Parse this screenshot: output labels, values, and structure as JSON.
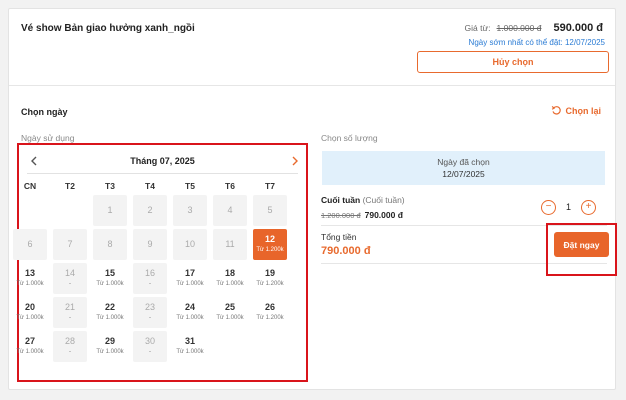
{
  "show": {
    "title": "Vé show Bản giao hưởng xanh_ngồi",
    "price_from_label": "Giá từ:",
    "price_old": "1.000.000 đ",
    "price_new": "590.000 đ",
    "earliest": "Ngày sớm nhất có thể đặt: 12/07/2025",
    "cancel_label": "Hủy chọn"
  },
  "date_section": {
    "title": "Chọn ngày",
    "reset_label": "Chọn lại",
    "usage_label": "Ngày sử dụng"
  },
  "calendar": {
    "month_label": "Tháng 07, 2025",
    "weekdays": [
      "CN",
      "T2",
      "T3",
      "T4",
      "T5",
      "T6",
      "T7"
    ],
    "cells": [
      {
        "day": "1",
        "sub": "",
        "state": "disabled"
      },
      {
        "day": "2",
        "sub": "",
        "state": "disabled"
      },
      {
        "day": "3",
        "sub": "",
        "state": "disabled"
      },
      {
        "day": "4",
        "sub": "",
        "state": "disabled"
      },
      {
        "day": "5",
        "sub": "",
        "state": "disabled"
      },
      {
        "day": "6",
        "sub": "",
        "state": "disabled"
      },
      {
        "day": "7",
        "sub": "",
        "state": "disabled"
      },
      {
        "day": "8",
        "sub": "",
        "state": "disabled"
      },
      {
        "day": "9",
        "sub": "",
        "state": "disabled"
      },
      {
        "day": "10",
        "sub": "",
        "state": "disabled"
      },
      {
        "day": "11",
        "sub": "",
        "state": "disabled"
      },
      {
        "day": "12",
        "sub": "Từ 1.200k",
        "state": "selected"
      },
      {
        "day": "13",
        "sub": "Từ 1.000k",
        "state": "available"
      },
      {
        "day": "14",
        "sub": "-",
        "state": "disabled"
      },
      {
        "day": "15",
        "sub": "Từ 1.000k",
        "state": "available"
      },
      {
        "day": "16",
        "sub": "-",
        "state": "disabled"
      },
      {
        "day": "17",
        "sub": "Từ 1.000k",
        "state": "available"
      },
      {
        "day": "18",
        "sub": "Từ 1.000k",
        "state": "available"
      },
      {
        "day": "19",
        "sub": "Từ 1.200k",
        "state": "available"
      },
      {
        "day": "20",
        "sub": "Từ 1.000k",
        "state": "available"
      },
      {
        "day": "21",
        "sub": "-",
        "state": "disabled"
      },
      {
        "day": "22",
        "sub": "Từ 1.000k",
        "state": "available"
      },
      {
        "day": "23",
        "sub": "-",
        "state": "disabled"
      },
      {
        "day": "24",
        "sub": "Từ 1.000k",
        "state": "available"
      },
      {
        "day": "25",
        "sub": "Từ 1.000k",
        "state": "available"
      },
      {
        "day": "26",
        "sub": "Từ 1.200k",
        "state": "available"
      },
      {
        "day": "27",
        "sub": "Từ 1.000k",
        "state": "available"
      },
      {
        "day": "28",
        "sub": "-",
        "state": "disabled"
      },
      {
        "day": "29",
        "sub": "Từ 1.000k",
        "state": "available"
      },
      {
        "day": "30",
        "sub": "-",
        "state": "disabled"
      },
      {
        "day": "31",
        "sub": "Từ 1.000k",
        "state": "available"
      }
    ]
  },
  "quantity": {
    "label": "Chọn số lượng",
    "picked_label": "Ngày đã chọn",
    "picked_date": "12/07/2025",
    "ticket_name": "Cuối tuần",
    "ticket_type": "(Cuối tuần)",
    "ticket_price_old": "1.200.000 đ",
    "ticket_price_new": "790.000 đ",
    "minus": "−",
    "plus": "+",
    "value": "1",
    "total_label": "Tổng tiền",
    "total_value": "790.000 đ",
    "book_label": "Đặt ngay"
  },
  "colors": {
    "accent": "#e8652a",
    "link": "#2a7bd4",
    "highlight": "#d9141b",
    "picked_bg": "#e1f0fb"
  }
}
